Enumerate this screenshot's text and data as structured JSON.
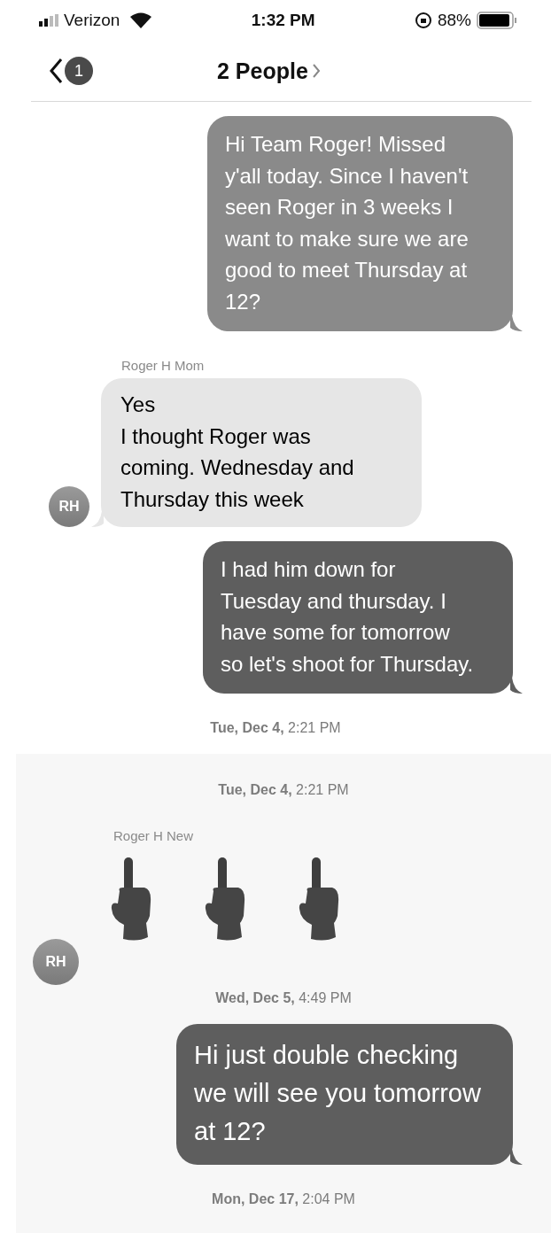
{
  "status_bar": {
    "carrier": "Verizon",
    "time": "1:32 PM",
    "battery": "88%"
  },
  "nav": {
    "badge": "1",
    "title": "2 People"
  },
  "sections": [
    {
      "kind": "plain",
      "items": [
        {
          "kind": "outgoing",
          "color": "#8a8a8a",
          "text": "Hi Team Roger! Missed y'all today. Since I haven't seen Roger in 3 weeks I want to make sure we are good to meet Thursday at 12?"
        },
        {
          "kind": "incoming",
          "sender": "Roger H Mom",
          "avatar": "RH",
          "text": "Yes\nI thought Roger was coming. Wednesday and Thursday this week"
        },
        {
          "kind": "outgoing",
          "color": "#5e5e5e",
          "text": "I had him down for Tuesday and thursday. I have some for tomorrow so let's shoot for Thursday."
        },
        {
          "kind": "timestamp",
          "day": "Tue, Dec 4,",
          "time": "2:21 PM"
        }
      ]
    },
    {
      "kind": "panel",
      "items": [
        {
          "kind": "timestamp",
          "day": "Tue, Dec 4,",
          "time": "2:21 PM"
        },
        {
          "kind": "emoji",
          "sender": "Roger H New",
          "avatar": "RH",
          "emoji": [
            {
              "kind": "hand"
            },
            {
              "kind": "hand"
            },
            {
              "kind": "hand"
            }
          ]
        },
        {
          "kind": "timestamp",
          "day": "Wed, Dec 5,",
          "time": "4:49 PM"
        },
        {
          "kind": "outgoing",
          "color": "#5e5e5e",
          "large": true,
          "text": "Hi just double checking we will see you tomorrow at 12?"
        },
        {
          "kind": "timestamp",
          "day": "Mon, Dec 17,",
          "time": "2:04 PM"
        }
      ]
    }
  ]
}
